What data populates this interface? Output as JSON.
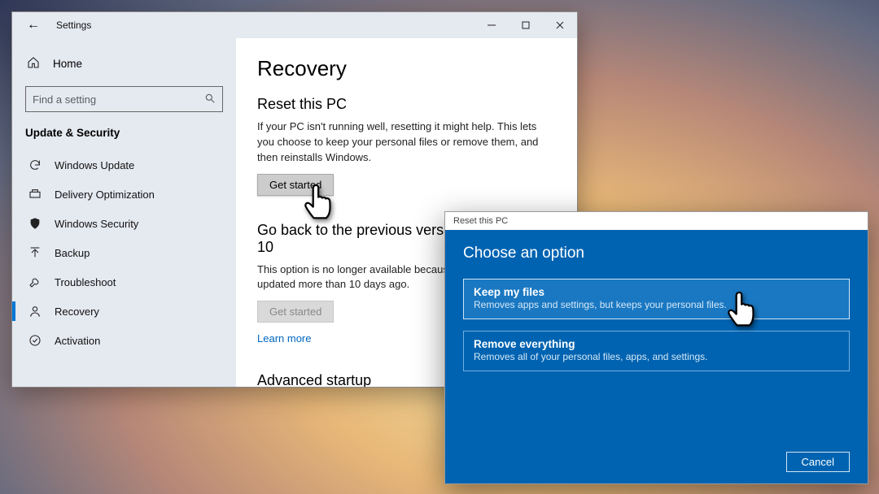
{
  "window": {
    "title": "Settings",
    "home": "Home",
    "search_placeholder": "Find a setting",
    "section": "Update & Security",
    "nav": [
      {
        "icon": "sync",
        "label": "Windows Update"
      },
      {
        "icon": "delivery",
        "label": "Delivery Optimization"
      },
      {
        "icon": "shield",
        "label": "Windows Security"
      },
      {
        "icon": "backup",
        "label": "Backup"
      },
      {
        "icon": "wrench",
        "label": "Troubleshoot"
      },
      {
        "icon": "recovery",
        "label": "Recovery"
      },
      {
        "icon": "activation",
        "label": "Activation"
      }
    ],
    "active_index": 5
  },
  "main": {
    "heading": "Recovery",
    "reset": {
      "heading": "Reset this PC",
      "body": "If your PC isn't running well, resetting it might help. This lets you choose to keep your personal files or remove them, and then reinstalls Windows.",
      "button": "Get started"
    },
    "goback": {
      "heading": "Go back to the previous version of Windows 10",
      "body": "This option is no longer available because your PC was updated more than 10 days ago.",
      "button": "Get started",
      "learn_more": "Learn more"
    },
    "advanced_heading": "Advanced startup"
  },
  "dialog": {
    "title": "Reset this PC",
    "heading": "Choose an option",
    "options": [
      {
        "title": "Keep my files",
        "desc": "Removes apps and settings, but keeps your personal files."
      },
      {
        "title": "Remove everything",
        "desc": "Removes all of your personal files, apps, and settings."
      }
    ],
    "cancel": "Cancel"
  }
}
